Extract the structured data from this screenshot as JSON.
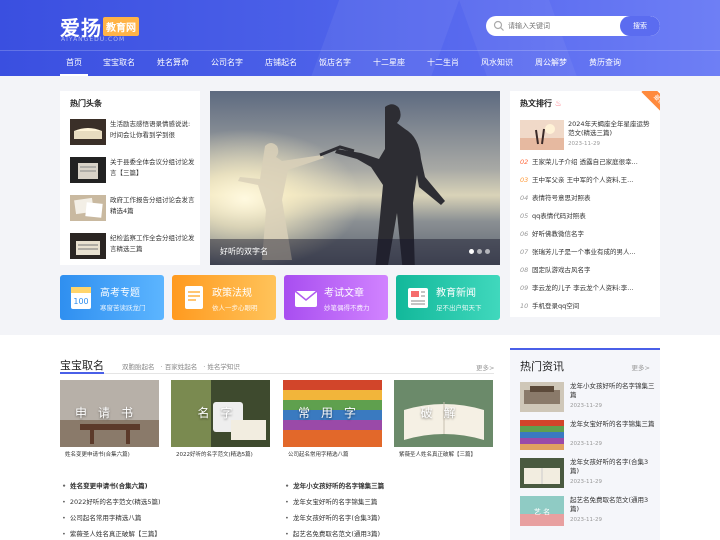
{
  "header": {
    "logo_text": "爱扬",
    "logo_badge": "教育网",
    "logo_sub": "AIYANGEDU.COM",
    "search_placeholder": "请输入关键词",
    "search_button": "搜索"
  },
  "nav": [
    "首页",
    "宝宝取名",
    "姓名算命",
    "公司名字",
    "店铺起名",
    "饭店名字",
    "十二星座",
    "十二生肖",
    "风水知识",
    "周公解梦",
    "黄历查询"
  ],
  "headlines": {
    "title": "热门头条",
    "items": [
      {
        "text": "生活励志感悟语录情感说说:时间会让你看到学到很"
      },
      {
        "text": "关于县委全体会议分组讨论发言【三篇】"
      },
      {
        "text": "政府工作报告分组讨论会发言精选4篇"
      },
      {
        "text": "纪检监察工作全会分组讨论发言精选三篇"
      }
    ]
  },
  "hero": {
    "caption": "好听的双字名"
  },
  "hot_rank": {
    "title": "热文排行",
    "new_tag": "最新",
    "top": {
      "title": "2024年天蝎座全年星座运势范文(精选三篇)",
      "date": "2023-11-29"
    },
    "items": [
      {
        "num": "02",
        "text": "王家荣儿子介绍 透露自己家庭很幸..."
      },
      {
        "num": "03",
        "text": "王中军父亲 王中军的个人资料,王..."
      },
      {
        "num": "04",
        "text": "表情符号意思对照表"
      },
      {
        "num": "05",
        "text": "qq表情代码对照表"
      },
      {
        "num": "06",
        "text": "好听佛教微信名字"
      },
      {
        "num": "07",
        "text": "张瑞芳儿子是一个事业有成的男人..."
      },
      {
        "num": "08",
        "text": "固定队游戏古风名字"
      },
      {
        "num": "09",
        "text": "李云龙的儿子 李云龙个人资料:李..."
      },
      {
        "num": "10",
        "text": "手机登录qq空间"
      }
    ]
  },
  "categories": [
    {
      "title": "高考专题",
      "sub": "寒窗苦读跃龙门",
      "icon": "calendar-icon",
      "color": "#3b9ff5"
    },
    {
      "title": "政策法规",
      "sub": "依人一步心眼明",
      "icon": "document-icon",
      "color": "#ffa726"
    },
    {
      "title": "考试文章",
      "sub": "妙笔偶得不费力",
      "icon": "envelope-icon",
      "color": "#b05cf0"
    },
    {
      "title": "教育新闻",
      "sub": "足不出户知天下",
      "icon": "newspaper-icon",
      "color": "#22c4a8"
    }
  ],
  "baby_names": {
    "title": "宝宝取名",
    "tabs": [
      "双胞胎起名",
      "百家姓起名",
      "姓名学知识"
    ],
    "more": "更多>",
    "cards": [
      {
        "overlay": "申请书",
        "label": "姓名变更申请书(合集六篇)"
      },
      {
        "overlay": "名字",
        "label": "2022好听的名字范文(精选5篇)"
      },
      {
        "overlay": "常用字",
        "label": "公司起名常用字精选八篇"
      },
      {
        "overlay": "破解",
        "label": "紫薇圣人姓名真正破解【三篇】"
      }
    ],
    "list_left": [
      "姓名变更申请书(合集六篇)",
      "2022好听的名字范文(精选5篇)",
      "公司起名常用字精选八篇",
      "紫薇圣人姓名真正破解【三篇】"
    ],
    "list_right": [
      "龙年小女孩好听的名字锦集三篇",
      "龙年女宝好听的名字锦集三篇",
      "龙年女孩好听的名字(合集3篇)",
      "起艺名免费取名范文(通用3篇)"
    ]
  },
  "hot_news": {
    "title": "热门资讯",
    "more": "更多>",
    "items": [
      {
        "title": "龙年小女孩好听的名字锦集三篇",
        "date": "2023-11-29"
      },
      {
        "title": "龙年女宝好听的名字锦集三篇",
        "date": "2023-11-29"
      },
      {
        "title": "龙年女孩好听的名字(合集3篇)",
        "date": "2023-11-29"
      },
      {
        "title": "起艺名免费取名范文(通用3篇)",
        "date": "2023-11-29"
      }
    ]
  }
}
